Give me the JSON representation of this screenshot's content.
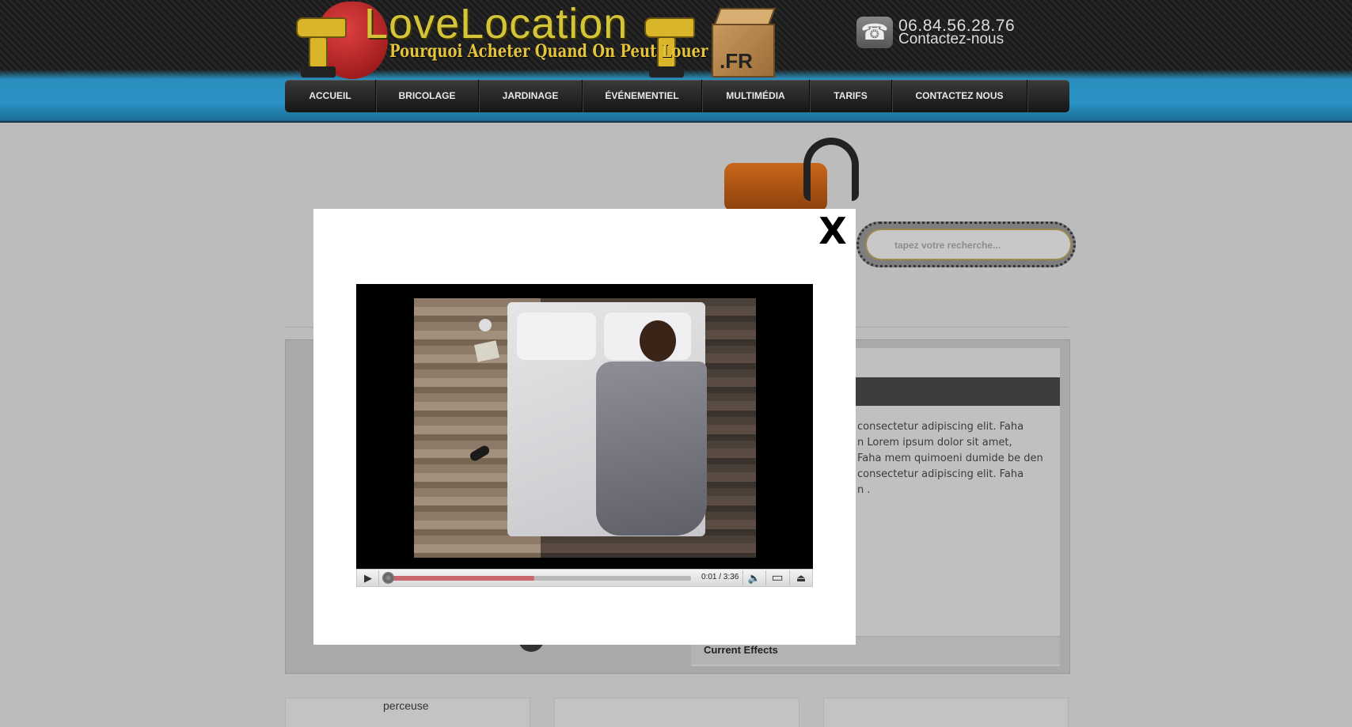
{
  "header": {
    "logo_title": "LoveLocation",
    "logo_subtitle": "Pourquoi Acheter Quand On Peut Louer",
    "logo_tld": ".FR",
    "phone": "06.84.56.28.76",
    "contact": "Contactez-nous",
    "phone_icon": "☎"
  },
  "nav": [
    {
      "label": "ACCUEIL"
    },
    {
      "label": "BRICOLAGE"
    },
    {
      "label": "JARDINAGE"
    },
    {
      "label": "ÉVÉNEMENTIEL"
    },
    {
      "label": "MULTIMÉDIA"
    },
    {
      "label": "TARIFS"
    },
    {
      "label": "CONTACTEZ NOUS"
    }
  ],
  "search": {
    "placeholder": "tapez votre recherche..."
  },
  "content": {
    "lorem_lines": [
      "consectetur adipiscing elit. Faha",
      "n Lorem ipsum dolor sit amet,",
      "Faha mem quimoeni dumide be den",
      "consectetur adipiscing elit. Faha",
      "n ."
    ],
    "effects_label": "Current Effects",
    "card1_label": "perceuse"
  },
  "modal": {
    "close_glyph": "X",
    "player": {
      "play_glyph": "▶",
      "time": "0:01 / 3:36",
      "progress_loaded": 0.49,
      "volume_glyph": "🔈",
      "size_glyph": "▭",
      "eject_glyph": "⏏"
    }
  },
  "colors": {
    "accent_blue": "#2a92c6",
    "nav_bg": "#1f1f1f",
    "logo_yellow": "#d4c43a",
    "progress_red": "#c9676e"
  }
}
